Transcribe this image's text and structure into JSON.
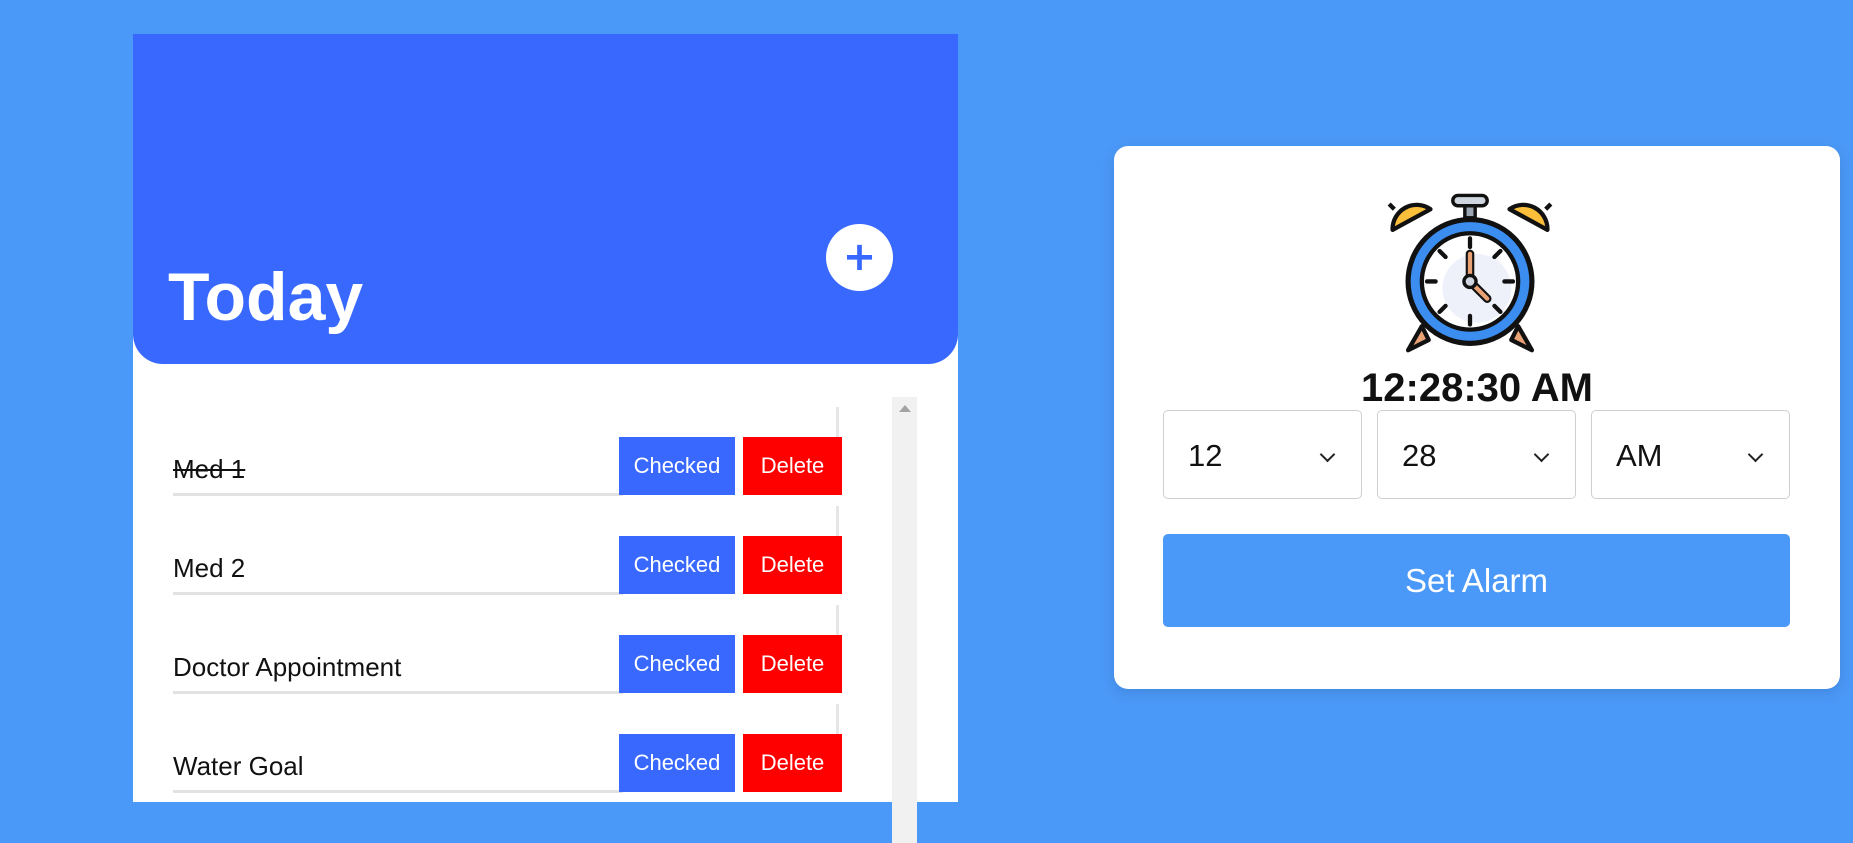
{
  "todo": {
    "title": "Today",
    "add_label": "+",
    "tasks": [
      {
        "name": "Med 1",
        "done": true,
        "checked_label": "Checked",
        "delete_label": "Delete"
      },
      {
        "name": "Med 2",
        "done": false,
        "checked_label": "Checked",
        "delete_label": "Delete"
      },
      {
        "name": "Doctor Appointment",
        "done": false,
        "checked_label": "Checked",
        "delete_label": "Delete"
      },
      {
        "name": "Water Goal",
        "done": false,
        "checked_label": "Checked",
        "delete_label": "Delete"
      }
    ]
  },
  "alarm": {
    "icon": "alarm-clock-icon",
    "current_time": "12:28:30 AM",
    "hour": "12",
    "minute": "28",
    "period": "AM",
    "set_label": "Set Alarm"
  },
  "colors": {
    "page_background": "#4a98f7",
    "header_blue": "#3868fe",
    "delete_red": "#ff0000",
    "card_white": "#ffffff"
  }
}
